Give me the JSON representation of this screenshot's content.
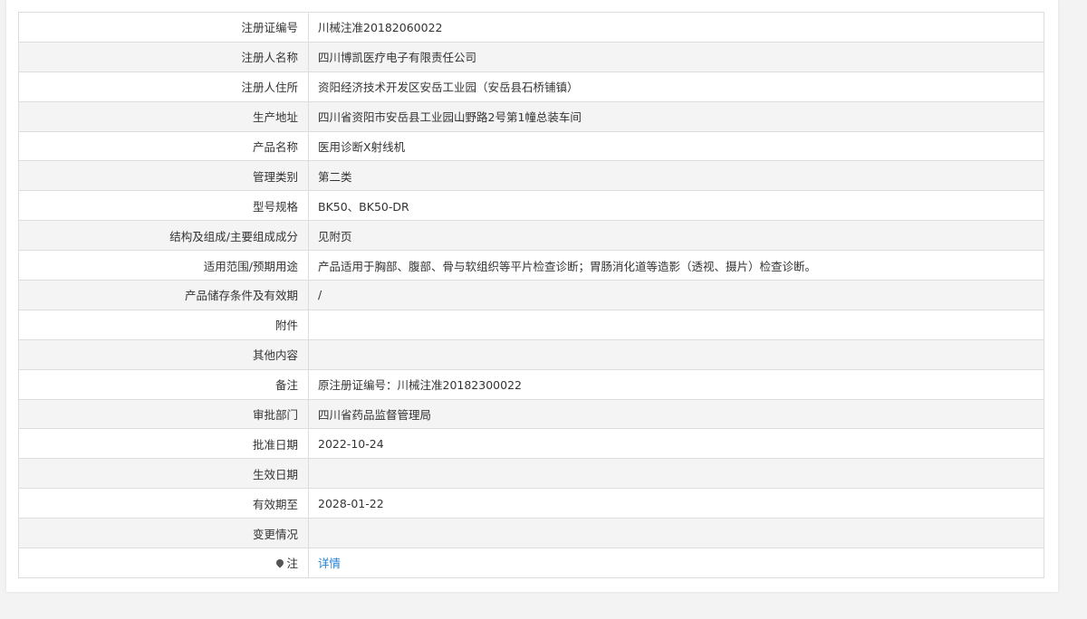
{
  "rows": [
    {
      "label": "注册证编号",
      "value": "川械注准20182060022"
    },
    {
      "label": "注册人名称",
      "value": "四川博凯医疗电子有限责任公司"
    },
    {
      "label": "注册人住所",
      "value": "资阳经济技术开发区安岳工业园（安岳县石桥铺镇）"
    },
    {
      "label": "生产地址",
      "value": "四川省资阳市安岳县工业园山野路2号第1幢总装车间"
    },
    {
      "label": "产品名称",
      "value": "医用诊断X射线机"
    },
    {
      "label": "管理类别",
      "value": "第二类"
    },
    {
      "label": "型号规格",
      "value": "BK50、BK50-DR"
    },
    {
      "label": "结构及组成/主要组成成分",
      "value": "见附页"
    },
    {
      "label": "适用范围/预期用途",
      "value": "产品适用于胸部、腹部、骨与软组织等平片检查诊断；胃肠消化道等造影（透视、摄片）检查诊断。"
    },
    {
      "label": "产品储存条件及有效期",
      "value": "/"
    },
    {
      "label": "附件",
      "value": ""
    },
    {
      "label": "其他内容",
      "value": ""
    },
    {
      "label": "备注",
      "value": "原注册证编号：川械注准20182300022"
    },
    {
      "label": "审批部门",
      "value": "四川省药品监督管理局"
    },
    {
      "label": "批准日期",
      "value": "2022-10-24"
    },
    {
      "label": "生效日期",
      "value": ""
    },
    {
      "label": "有效期至",
      "value": "2028-01-22"
    },
    {
      "label": "变更情况",
      "value": ""
    }
  ],
  "note": {
    "icon": "pin-icon",
    "label": "注",
    "link_text": "详情",
    "link_color": "#1f7fd1"
  }
}
